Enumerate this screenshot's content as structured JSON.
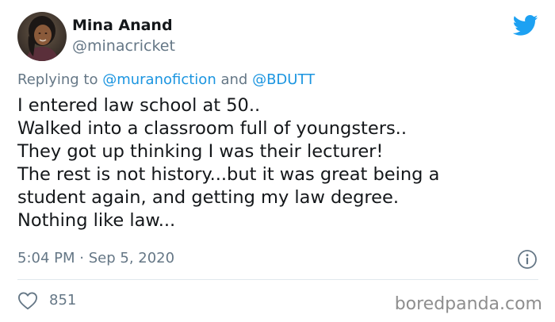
{
  "author": {
    "name": "Mina Anand",
    "handle": "@minacricket",
    "avatar_icon": "profile-photo"
  },
  "brand": {
    "icon": "twitter-bird-icon",
    "color": "#1da1f2"
  },
  "reply": {
    "prefix": "Replying to",
    "mention1": "@muranofiction",
    "conjunction": "and",
    "mention2": "@BDUTT"
  },
  "tweet": {
    "lines": [
      "I entered law school at 50..",
      "Walked into a classroom full of youngsters..",
      "They got up thinking I was their lecturer!",
      "The rest is not history...but it was great being a",
      "student again, and getting my law degree.",
      "Nothing like law..."
    ]
  },
  "meta": {
    "time": "5:04 PM",
    "separator": "·",
    "date": "Sep 5, 2020"
  },
  "engagement": {
    "likes": "851"
  },
  "watermark": "boredpanda.com",
  "colors": {
    "text": "#14171a",
    "secondary": "#657786",
    "link": "#1b95e0",
    "divider": "#e1e8ed"
  }
}
